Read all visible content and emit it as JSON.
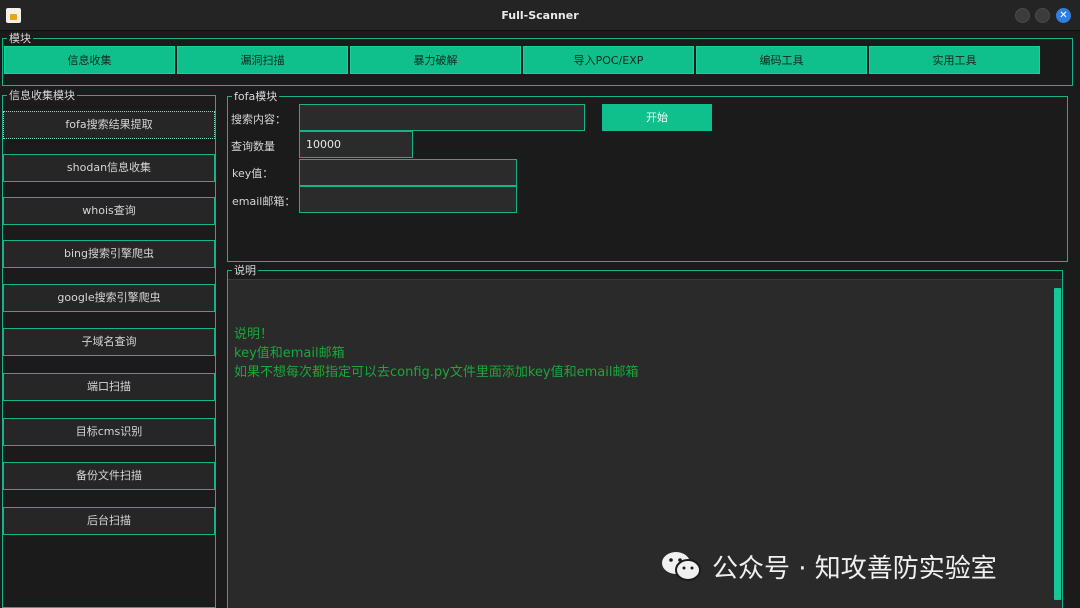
{
  "window": {
    "title": "Full-Scanner"
  },
  "modules": {
    "legend": "模块",
    "tabs": [
      "信息收集",
      "漏洞扫描",
      "暴力破解",
      "导入POC/EXP",
      "编码工具",
      "实用工具"
    ]
  },
  "sidebar": {
    "legend": "信息收集模块",
    "items": [
      "fofa搜索结果提取",
      "shodan信息收集",
      "whois查询",
      "bing搜索引擎爬虫",
      "google搜索引擎爬虫",
      "子域名查询",
      "端口扫描",
      "目标cms识别",
      "备份文件扫描",
      "后台扫描"
    ]
  },
  "fofa": {
    "legend": "fofa模块",
    "search_label": "搜索内容：",
    "search_value": "",
    "count_label": "查询数量",
    "count_value": "10000",
    "key_label": "key值：",
    "key_value": "",
    "email_label": "email邮箱：",
    "email_value": "",
    "start_label": "开始"
  },
  "description": {
    "legend": "说明",
    "lines": [
      "说明！",
      "key值和email邮箱",
      "如果不想每次都指定可以去config.py文件里面添加key值和email邮箱"
    ]
  },
  "watermark": {
    "text": "公众号 · 知攻善防实验室"
  },
  "colors": {
    "accent": "#0fbf8c",
    "border": "#19b38a",
    "desc_text": "#19a83a",
    "close_button": "#2f7fe0"
  }
}
